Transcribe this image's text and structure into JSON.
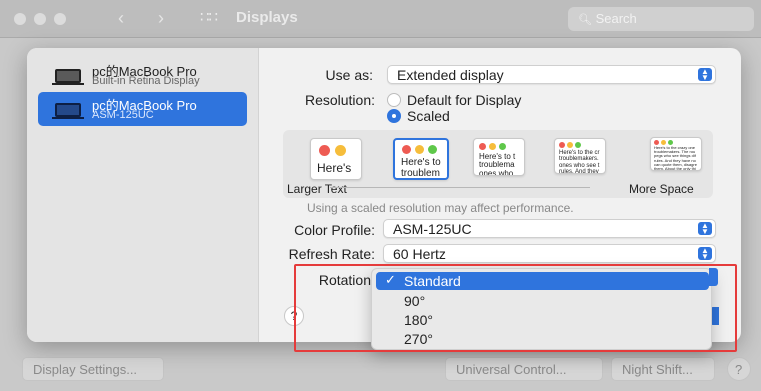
{
  "window": {
    "title": "Displays",
    "search_placeholder": "Search"
  },
  "bottom_buttons": {
    "display_settings": "Display Settings...",
    "universal_control": "Universal Control...",
    "night_shift": "Night Shift...",
    "help": "?"
  },
  "displays": [
    {
      "name": "pc的MacBook Pro",
      "subtitle": "Built-in Retina Display"
    },
    {
      "name": "pc的MacBook Pro",
      "subtitle": "ASM-125UC"
    }
  ],
  "settings": {
    "use_as_label": "Use as:",
    "use_as_value": "Extended display",
    "resolution_label": "Resolution:",
    "resolution_options": [
      "Default for Display",
      "Scaled"
    ],
    "resolution_selected": "Scaled",
    "preview_text": [
      "Here's",
      "Here's to troublem",
      "Here's to t troublema ones who",
      "Here's to the cr troublemakers. ones who see t rules. And they",
      "Here's to the crazy one troublemakers. The rou pegs who see things dif rules. And they have no can quote them, disagre them. About the only thi Because they change th"
    ],
    "larger_text": "Larger Text",
    "more_space": "More Space",
    "scale_note": "Using a scaled resolution may affect performance.",
    "color_profile_label": "Color Profile:",
    "color_profile_value": "ASM-125UC",
    "refresh_rate_label": "Refresh Rate:",
    "refresh_rate_value": "60 Hertz",
    "rotation_label": "Rotation",
    "help": "?"
  },
  "rotation_menu": {
    "selected_index": 0,
    "options": [
      "Standard",
      "90°",
      "180°",
      "270°"
    ],
    "check": "✓"
  },
  "colors": {
    "accent": "#2f74dd",
    "highlight_box": "#e53b3b",
    "traffic_red": "#ee5b53",
    "traffic_yellow": "#f6bd3b",
    "traffic_green": "#5fc84a"
  },
  "icons": {
    "back": "chevron-left-icon",
    "forward": "chevron-right-icon",
    "grid": "grid-icon",
    "search": "search-icon",
    "display": "display-icon",
    "popup": "chevron-updown-icon"
  }
}
